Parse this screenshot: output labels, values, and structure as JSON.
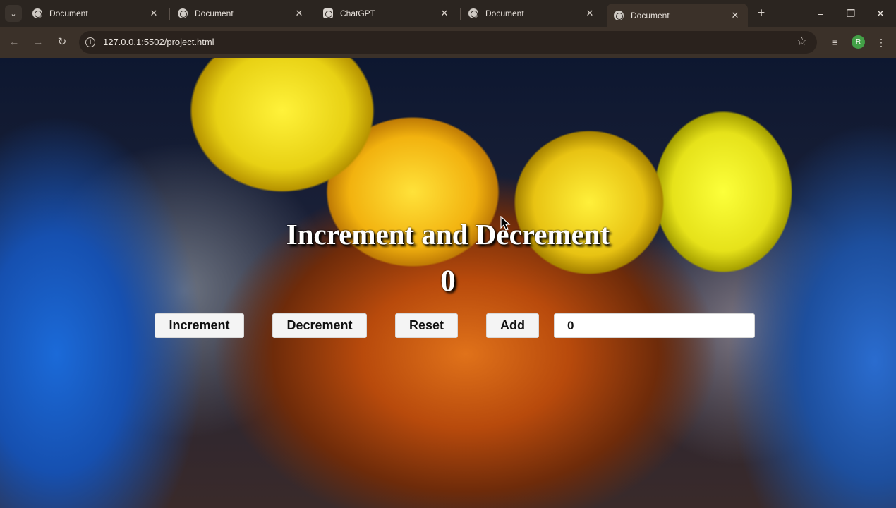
{
  "browser": {
    "tabs": [
      {
        "title": "Document",
        "favicon": "globe-icon",
        "active": false
      },
      {
        "title": "Document",
        "favicon": "globe-icon",
        "active": false
      },
      {
        "title": "ChatGPT",
        "favicon": "chatgpt-icon",
        "active": false
      },
      {
        "title": "Document",
        "favicon": "globe-icon",
        "active": false
      },
      {
        "title": "Document",
        "favicon": "globe-icon",
        "active": true
      }
    ],
    "url": "127.0.0.1:5502/project.html",
    "profile_initial": "R"
  },
  "page": {
    "heading": "Increment and Decrement",
    "counter_value": "0",
    "buttons": {
      "increment": "Increment",
      "decrement": "Decrement",
      "reset": "Reset",
      "add": "Add"
    },
    "add_input_value": "0"
  },
  "colors": {
    "tabstrip": "#2b2520",
    "toolbar": "#3b3129",
    "heading_text": "#ffffff",
    "button_bg": "#f4f4f4"
  }
}
